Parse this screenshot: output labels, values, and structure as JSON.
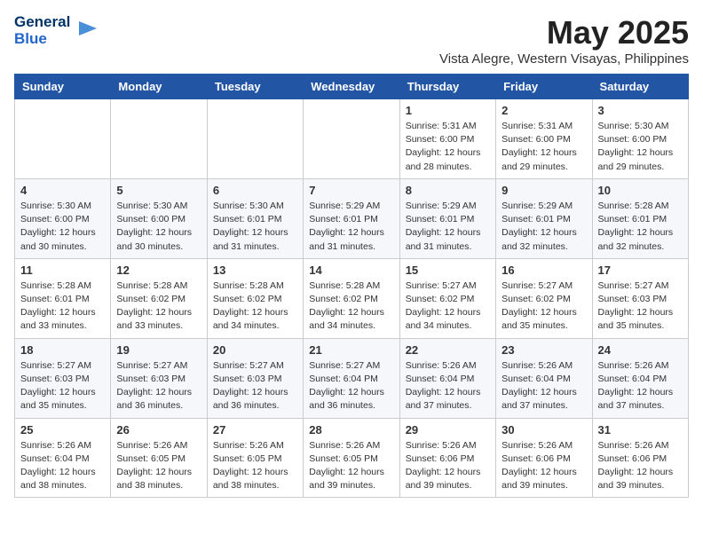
{
  "header": {
    "logo_line1": "General",
    "logo_line2": "Blue",
    "month": "May 2025",
    "location": "Vista Alegre, Western Visayas, Philippines"
  },
  "weekdays": [
    "Sunday",
    "Monday",
    "Tuesday",
    "Wednesday",
    "Thursday",
    "Friday",
    "Saturday"
  ],
  "weeks": [
    [
      {
        "day": "",
        "sunrise": "",
        "sunset": "",
        "daylight": ""
      },
      {
        "day": "",
        "sunrise": "",
        "sunset": "",
        "daylight": ""
      },
      {
        "day": "",
        "sunrise": "",
        "sunset": "",
        "daylight": ""
      },
      {
        "day": "",
        "sunrise": "",
        "sunset": "",
        "daylight": ""
      },
      {
        "day": "1",
        "sunrise": "Sunrise: 5:31 AM",
        "sunset": "Sunset: 6:00 PM",
        "daylight": "Daylight: 12 hours and 28 minutes."
      },
      {
        "day": "2",
        "sunrise": "Sunrise: 5:31 AM",
        "sunset": "Sunset: 6:00 PM",
        "daylight": "Daylight: 12 hours and 29 minutes."
      },
      {
        "day": "3",
        "sunrise": "Sunrise: 5:30 AM",
        "sunset": "Sunset: 6:00 PM",
        "daylight": "Daylight: 12 hours and 29 minutes."
      }
    ],
    [
      {
        "day": "4",
        "sunrise": "Sunrise: 5:30 AM",
        "sunset": "Sunset: 6:00 PM",
        "daylight": "Daylight: 12 hours and 30 minutes."
      },
      {
        "day": "5",
        "sunrise": "Sunrise: 5:30 AM",
        "sunset": "Sunset: 6:00 PM",
        "daylight": "Daylight: 12 hours and 30 minutes."
      },
      {
        "day": "6",
        "sunrise": "Sunrise: 5:30 AM",
        "sunset": "Sunset: 6:01 PM",
        "daylight": "Daylight: 12 hours and 31 minutes."
      },
      {
        "day": "7",
        "sunrise": "Sunrise: 5:29 AM",
        "sunset": "Sunset: 6:01 PM",
        "daylight": "Daylight: 12 hours and 31 minutes."
      },
      {
        "day": "8",
        "sunrise": "Sunrise: 5:29 AM",
        "sunset": "Sunset: 6:01 PM",
        "daylight": "Daylight: 12 hours and 31 minutes."
      },
      {
        "day": "9",
        "sunrise": "Sunrise: 5:29 AM",
        "sunset": "Sunset: 6:01 PM",
        "daylight": "Daylight: 12 hours and 32 minutes."
      },
      {
        "day": "10",
        "sunrise": "Sunrise: 5:28 AM",
        "sunset": "Sunset: 6:01 PM",
        "daylight": "Daylight: 12 hours and 32 minutes."
      }
    ],
    [
      {
        "day": "11",
        "sunrise": "Sunrise: 5:28 AM",
        "sunset": "Sunset: 6:01 PM",
        "daylight": "Daylight: 12 hours and 33 minutes."
      },
      {
        "day": "12",
        "sunrise": "Sunrise: 5:28 AM",
        "sunset": "Sunset: 6:02 PM",
        "daylight": "Daylight: 12 hours and 33 minutes."
      },
      {
        "day": "13",
        "sunrise": "Sunrise: 5:28 AM",
        "sunset": "Sunset: 6:02 PM",
        "daylight": "Daylight: 12 hours and 34 minutes."
      },
      {
        "day": "14",
        "sunrise": "Sunrise: 5:28 AM",
        "sunset": "Sunset: 6:02 PM",
        "daylight": "Daylight: 12 hours and 34 minutes."
      },
      {
        "day": "15",
        "sunrise": "Sunrise: 5:27 AM",
        "sunset": "Sunset: 6:02 PM",
        "daylight": "Daylight: 12 hours and 34 minutes."
      },
      {
        "day": "16",
        "sunrise": "Sunrise: 5:27 AM",
        "sunset": "Sunset: 6:02 PM",
        "daylight": "Daylight: 12 hours and 35 minutes."
      },
      {
        "day": "17",
        "sunrise": "Sunrise: 5:27 AM",
        "sunset": "Sunset: 6:03 PM",
        "daylight": "Daylight: 12 hours and 35 minutes."
      }
    ],
    [
      {
        "day": "18",
        "sunrise": "Sunrise: 5:27 AM",
        "sunset": "Sunset: 6:03 PM",
        "daylight": "Daylight: 12 hours and 35 minutes."
      },
      {
        "day": "19",
        "sunrise": "Sunrise: 5:27 AM",
        "sunset": "Sunset: 6:03 PM",
        "daylight": "Daylight: 12 hours and 36 minutes."
      },
      {
        "day": "20",
        "sunrise": "Sunrise: 5:27 AM",
        "sunset": "Sunset: 6:03 PM",
        "daylight": "Daylight: 12 hours and 36 minutes."
      },
      {
        "day": "21",
        "sunrise": "Sunrise: 5:27 AM",
        "sunset": "Sunset: 6:04 PM",
        "daylight": "Daylight: 12 hours and 36 minutes."
      },
      {
        "day": "22",
        "sunrise": "Sunrise: 5:26 AM",
        "sunset": "Sunset: 6:04 PM",
        "daylight": "Daylight: 12 hours and 37 minutes."
      },
      {
        "day": "23",
        "sunrise": "Sunrise: 5:26 AM",
        "sunset": "Sunset: 6:04 PM",
        "daylight": "Daylight: 12 hours and 37 minutes."
      },
      {
        "day": "24",
        "sunrise": "Sunrise: 5:26 AM",
        "sunset": "Sunset: 6:04 PM",
        "daylight": "Daylight: 12 hours and 37 minutes."
      }
    ],
    [
      {
        "day": "25",
        "sunrise": "Sunrise: 5:26 AM",
        "sunset": "Sunset: 6:04 PM",
        "daylight": "Daylight: 12 hours and 38 minutes."
      },
      {
        "day": "26",
        "sunrise": "Sunrise: 5:26 AM",
        "sunset": "Sunset: 6:05 PM",
        "daylight": "Daylight: 12 hours and 38 minutes."
      },
      {
        "day": "27",
        "sunrise": "Sunrise: 5:26 AM",
        "sunset": "Sunset: 6:05 PM",
        "daylight": "Daylight: 12 hours and 38 minutes."
      },
      {
        "day": "28",
        "sunrise": "Sunrise: 5:26 AM",
        "sunset": "Sunset: 6:05 PM",
        "daylight": "Daylight: 12 hours and 39 minutes."
      },
      {
        "day": "29",
        "sunrise": "Sunrise: 5:26 AM",
        "sunset": "Sunset: 6:06 PM",
        "daylight": "Daylight: 12 hours and 39 minutes."
      },
      {
        "day": "30",
        "sunrise": "Sunrise: 5:26 AM",
        "sunset": "Sunset: 6:06 PM",
        "daylight": "Daylight: 12 hours and 39 minutes."
      },
      {
        "day": "31",
        "sunrise": "Sunrise: 5:26 AM",
        "sunset": "Sunset: 6:06 PM",
        "daylight": "Daylight: 12 hours and 39 minutes."
      }
    ]
  ]
}
